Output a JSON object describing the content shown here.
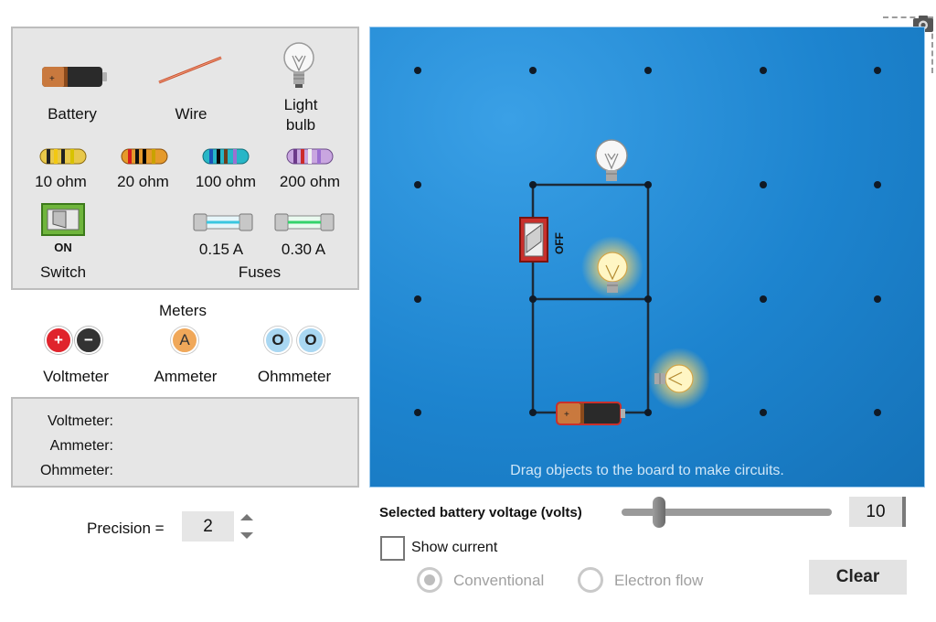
{
  "palette": {
    "battery": {
      "label": "Battery"
    },
    "wire": {
      "label": "Wire"
    },
    "light_bulb": {
      "label_line1": "Light",
      "label_line2": "bulb"
    },
    "resistors": [
      {
        "label": "10 ohm",
        "bands": [
          "#222222",
          "#f2c811",
          "#222222",
          "#d8c200"
        ]
      },
      {
        "label": "20 ohm",
        "bands": [
          "#d61e1e",
          "#111111",
          "#000000",
          "#c9a200"
        ]
      },
      {
        "label": "100 ohm",
        "bands": [
          "#1b54b8",
          "#0a0a0a",
          "#6d3e1c",
          "#9c6fd1"
        ]
      },
      {
        "label": "200 ohm",
        "bands": [
          "#6c3a8a",
          "#cc2a2a",
          "#f0f0f0",
          "#9c6fd1"
        ]
      }
    ],
    "switch": {
      "state": "ON",
      "label": "Switch"
    },
    "fuses": [
      {
        "label": "0.15 A",
        "color": "#3ac7e0"
      },
      {
        "label": "0.30 A",
        "color": "#33d36b"
      }
    ],
    "fuses_label": "Fuses"
  },
  "meters": {
    "title": "Meters",
    "voltmeter": {
      "label": "Voltmeter",
      "plus": "+",
      "minus": "−"
    },
    "ammeter": {
      "label": "Ammeter",
      "symbol": "A"
    },
    "ohmmeter": {
      "label": "Ohmmeter",
      "symbol": "O"
    }
  },
  "readouts": {
    "voltmeter": "Voltmeter:",
    "ammeter": "Ammeter:",
    "ohmmeter": "Ohmmeter:"
  },
  "precision": {
    "label": "Precision =",
    "value": "2"
  },
  "board": {
    "hint": "Drag objects to the board to make circuits.",
    "switch_state": "OFF",
    "color": "#1d84cf"
  },
  "controls": {
    "voltage_label": "Selected battery voltage (volts)",
    "voltage_value": "10",
    "voltage_slider_fraction": 0.17,
    "show_current": "Show current",
    "show_current_checked": false,
    "radio_conventional": "Conventional",
    "radio_electron": "Electron flow",
    "clear": "Clear"
  },
  "icons": [
    "camera-icon",
    "battery-icon",
    "wire-icon",
    "light-bulb-icon",
    "resistor-icon",
    "switch-icon",
    "fuse-icon"
  ]
}
